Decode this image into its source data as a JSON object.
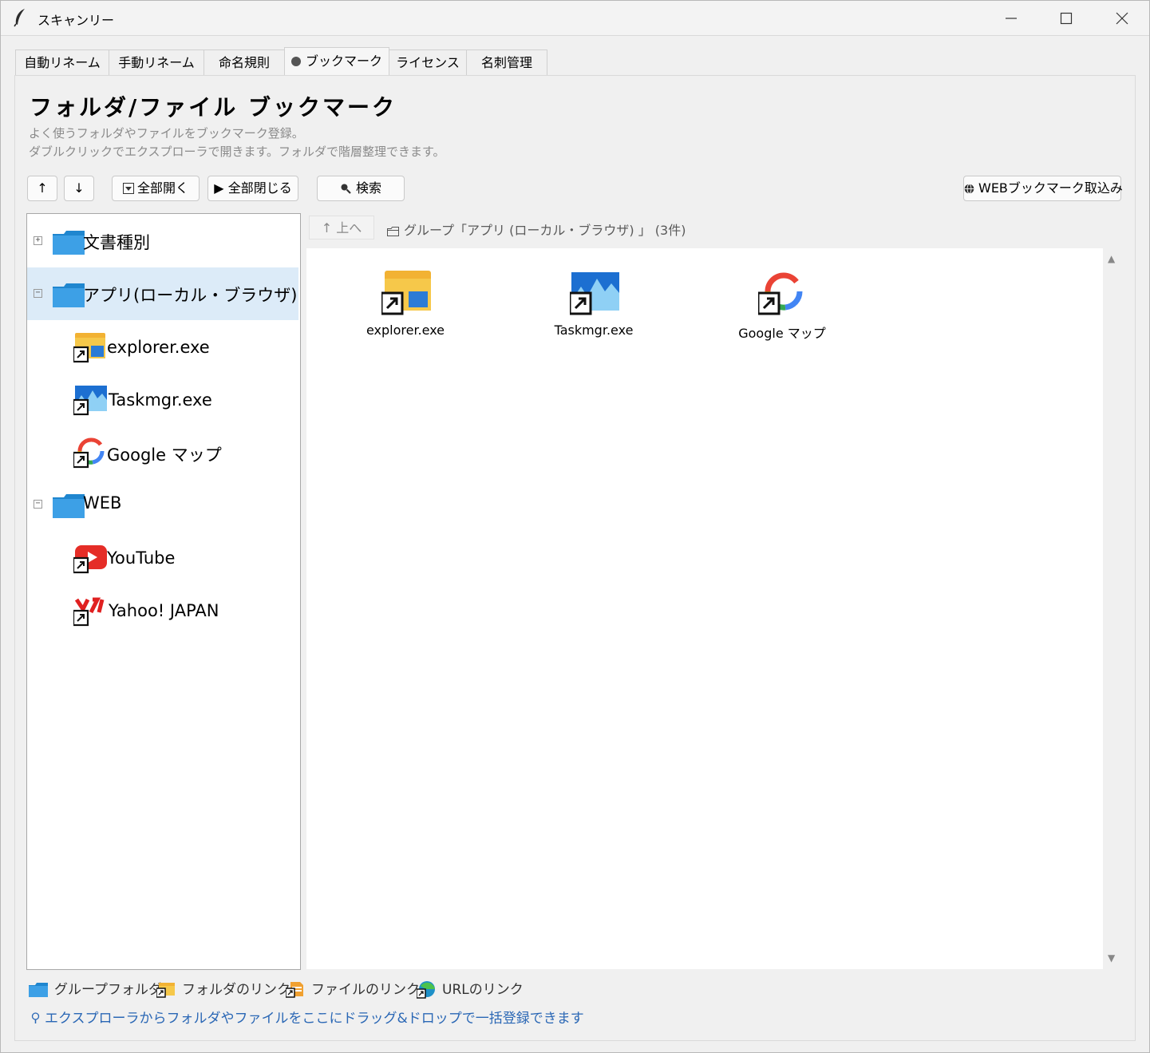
{
  "window": {
    "title": "スキャンリー"
  },
  "tabs": [
    {
      "label": "自動リネーム"
    },
    {
      "label": "手動リネーム"
    },
    {
      "label": "命名規則"
    },
    {
      "label": "ブックマーク",
      "active": true
    },
    {
      "label": "ライセンス"
    },
    {
      "label": "名刺管理"
    }
  ],
  "page": {
    "heading": "フォルダ/ファイル ブックマーク",
    "desc1": "よく使うフォルダやファイルをブックマーク登録。",
    "desc2": "ダブルクリックでエクスプローラで開きます。フォルダで階層整理できます。"
  },
  "toolbar": {
    "up": "↑",
    "down": "↓",
    "expand_all": "全部開く",
    "collapse_all": "▶ 全部閉じる",
    "search": "検索",
    "web_import": "WEBブックマーク取込み"
  },
  "tree": {
    "groups": [
      {
        "label": "文書種別",
        "expander": "+"
      },
      {
        "label": "アプリ(ローカル・ブラウザ)",
        "expander": "−",
        "selected": true
      },
      {
        "label": "explorer.exe",
        "icon": "explorer-icon"
      },
      {
        "label": "Taskmgr.exe",
        "icon": "taskmgr-icon"
      },
      {
        "label": "Google マップ",
        "icon": "google-maps-icon"
      },
      {
        "label": "WEB",
        "expander": "−"
      },
      {
        "label": "YouTube",
        "icon": "youtube-icon"
      },
      {
        "label": "Yahoo! JAPAN",
        "icon": "yahoo-icon"
      }
    ]
  },
  "breadcrumb": {
    "up_label": "↑ 上へ",
    "text": "グループ「アプリ (ローカル・ブラウザ) 」 (3件)"
  },
  "content": {
    "items": [
      {
        "label": "explorer.exe",
        "icon": "explorer-icon"
      },
      {
        "label": "Taskmgr.exe",
        "icon": "taskmgr-icon"
      },
      {
        "label": "Google マップ",
        "icon": "google-maps-icon"
      }
    ]
  },
  "legend": {
    "group_folder": "グループフォルダ",
    "folder_link": "フォルダのリンク",
    "file_link": "ファイルのリンク",
    "url_link": "URLのリンク",
    "tip": "エクスプローラからフォルダやファイルをここにドラッグ&ドロップで一括登録できます"
  },
  "colors": {
    "accent": "#2a67b5",
    "folder_blue": "#2f9ae0",
    "selection": "#dcebf8"
  }
}
